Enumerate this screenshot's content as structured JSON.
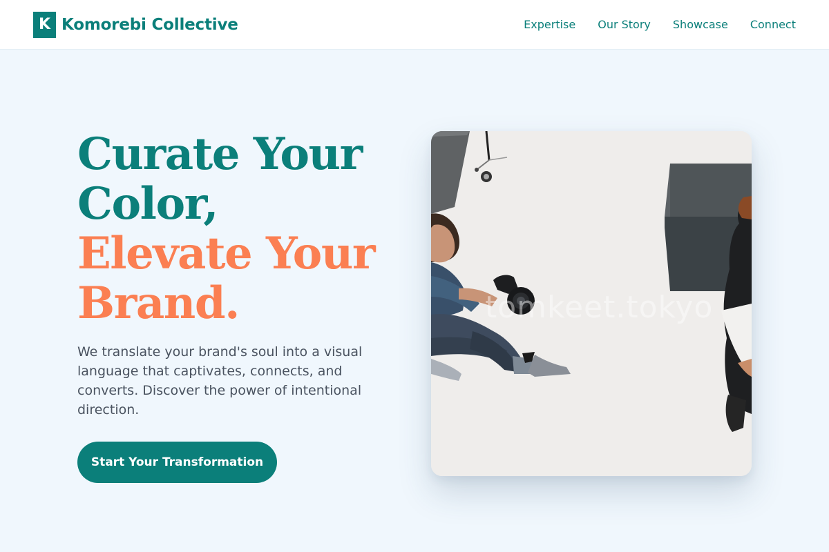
{
  "brand": {
    "logo_letter": "K",
    "name": "Komorebi Collective",
    "color": "#0b7f7a"
  },
  "nav": {
    "items": [
      {
        "label": "Expertise"
      },
      {
        "label": "Our Story"
      },
      {
        "label": "Showcase"
      },
      {
        "label": "Connect"
      }
    ]
  },
  "hero": {
    "headline_lines": [
      "Curate Your",
      "Color,",
      "Elevate Your",
      "Brand."
    ],
    "headline_colors": [
      "#0b7f7a",
      "#fb7f52"
    ],
    "description": "We translate your brand's soul into a visual language that captivates, connects, and converts. Discover the power of intentional direction.",
    "cta_label": "Start Your Transformation",
    "image": {
      "watermark": "tomkeet.tokyo",
      "subject": "photographer-shooting-model-icon"
    }
  }
}
